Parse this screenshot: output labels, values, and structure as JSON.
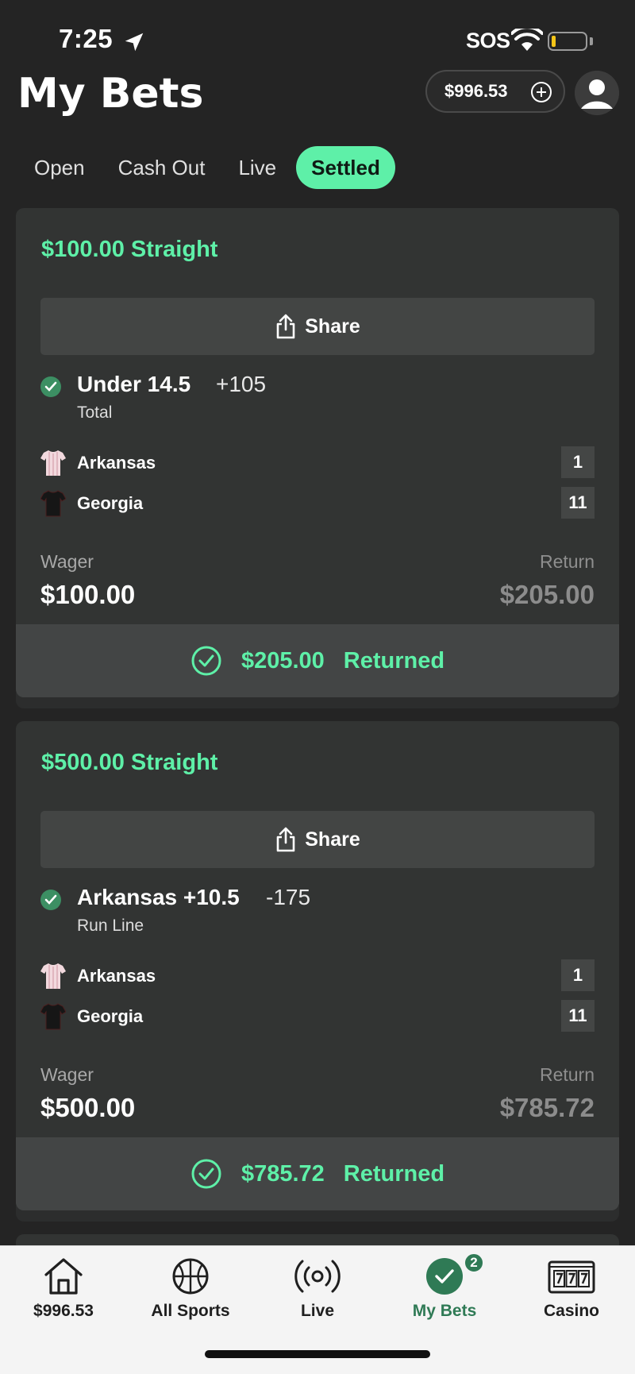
{
  "status_bar": {
    "time": "7:25",
    "carrier": "SOS"
  },
  "header": {
    "title": "My Bets",
    "balance": "$996.53"
  },
  "tabs": [
    {
      "label": "Open",
      "active": false
    },
    {
      "label": "Cash Out",
      "active": false
    },
    {
      "label": "Live",
      "active": false
    },
    {
      "label": "Settled",
      "active": true
    }
  ],
  "bets": [
    {
      "title": "$100.00 Straight",
      "share_label": "Share",
      "pick": "Under 14.5",
      "odds": "+105",
      "market": "Total",
      "teams": [
        {
          "name": "Arkansas",
          "score": "1",
          "jersey": "arkansas-jersey-icon"
        },
        {
          "name": "Georgia",
          "score": "11",
          "jersey": "georgia-jersey-icon"
        }
      ],
      "wager_label": "Wager",
      "wager": "$100.00",
      "return_label": "Return",
      "return": "$205.00",
      "returned_amount": "$205.00",
      "returned_label": "Returned"
    },
    {
      "title": "$500.00 Straight",
      "share_label": "Share",
      "pick": "Arkansas +10.5",
      "odds": "-175",
      "market": "Run Line",
      "teams": [
        {
          "name": "Arkansas",
          "score": "1",
          "jersey": "arkansas-jersey-icon"
        },
        {
          "name": "Georgia",
          "score": "11",
          "jersey": "georgia-jersey-icon"
        }
      ],
      "wager_label": "Wager",
      "wager": "$500.00",
      "return_label": "Return",
      "return": "$785.72",
      "returned_amount": "$785.72",
      "returned_label": "Returned"
    }
  ],
  "bottom_nav": [
    {
      "label": "$996.53",
      "icon": "home-icon"
    },
    {
      "label": "All Sports",
      "icon": "basketball-icon"
    },
    {
      "label": "Live",
      "icon": "live-broadcast-icon"
    },
    {
      "label": "My Bets",
      "icon": "check-circle-icon",
      "badge": "2",
      "active": true
    },
    {
      "label": "Casino",
      "icon": "slot-machine-icon"
    }
  ],
  "colors": {
    "accent": "#5ef0a8",
    "nav_active": "#2f7a55",
    "background": "#242424",
    "card": "#323433"
  }
}
